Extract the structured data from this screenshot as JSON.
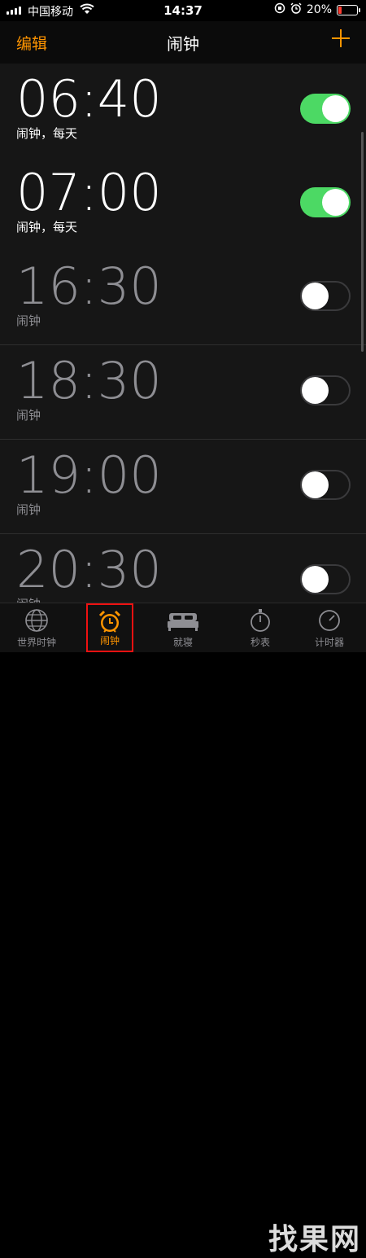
{
  "status": {
    "carrier": "中国移动",
    "time": "14:37",
    "battery": "20%",
    "battery_level": 0.2,
    "battery_color": "#ff3b30"
  },
  "nav": {
    "edit": "编辑",
    "title": "闹钟"
  },
  "alarms": [
    {
      "time": "06:40",
      "label": "闹钟，每天",
      "enabled": true
    },
    {
      "time": "07:00",
      "label": "闹钟，每天",
      "enabled": true
    },
    {
      "time": "16:30",
      "label": "闹钟",
      "enabled": false
    },
    {
      "time": "18:30",
      "label": "闹钟",
      "enabled": false
    },
    {
      "time": "19:00",
      "label": "闹钟",
      "enabled": false
    },
    {
      "time": "20:30",
      "label": "闹钟",
      "enabled": false
    }
  ],
  "tabs": [
    {
      "label": "世界时钟",
      "icon": "globe-icon"
    },
    {
      "label": "闹钟",
      "icon": "alarm-clock-icon",
      "active": true
    },
    {
      "label": "就寝",
      "icon": "bed-icon"
    },
    {
      "label": "秒表",
      "icon": "stopwatch-icon"
    },
    {
      "label": "计时器",
      "icon": "timer-icon"
    }
  ],
  "watermark": "找果网",
  "colors": {
    "accent": "#ff9500",
    "toggle_on": "#4cd964"
  }
}
